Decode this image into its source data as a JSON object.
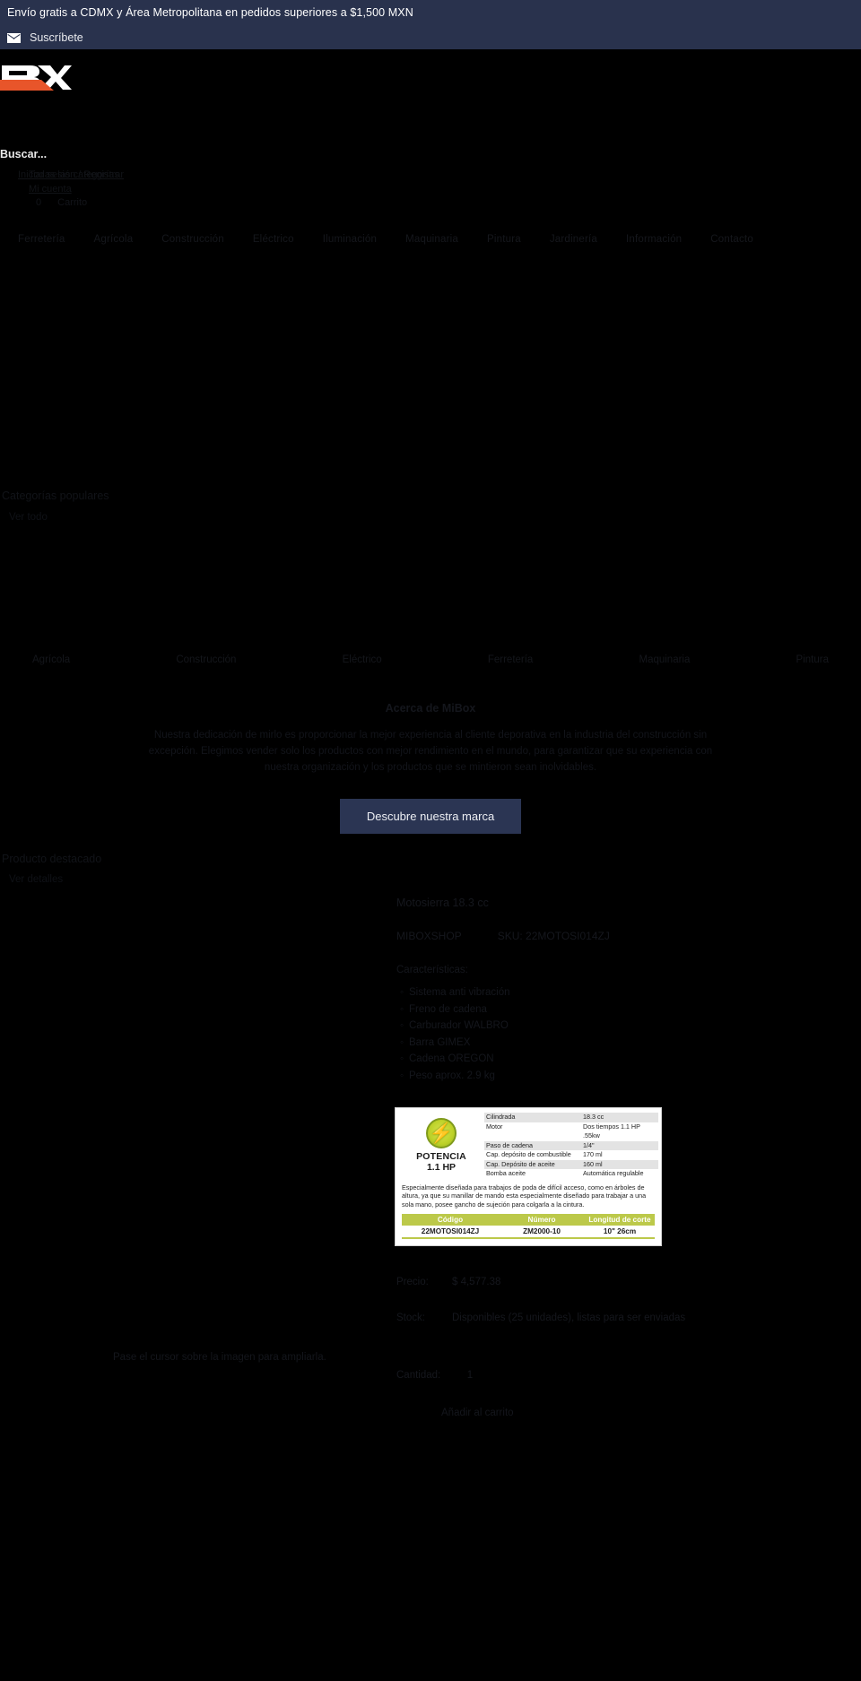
{
  "announcement": {
    "text": "Envío gratis a CDMX y Área Metropolitana en pedidos superiores a $1,500 MXN",
    "subscribe_label": "Suscríbete",
    "mail_icon": "envelope-icon",
    "bar_color": "#29324d"
  },
  "header": {
    "logo_text": "BOX",
    "logo_accent": "#e8552a",
    "search_placeholder": "Buscar...",
    "account": {
      "login_register": "Iniciar sesión / Registrar",
      "all_categories": "Todas las categorías",
      "my_account": "Mi cuenta"
    },
    "cart": {
      "count": "0",
      "label": "Carrito",
      "icon": "cart-icon"
    }
  },
  "nav": {
    "items": [
      {
        "label": "Ferretería"
      },
      {
        "label": "Agrícola"
      },
      {
        "label": "Construcción"
      },
      {
        "label": "Eléctrico"
      },
      {
        "label": "Iluminación"
      },
      {
        "label": "Maquinaria"
      },
      {
        "label": "Pintura"
      },
      {
        "label": "Jardinería"
      },
      {
        "label": "Información"
      },
      {
        "label": "Contacto"
      }
    ]
  },
  "popular": {
    "title": "Categorías populares",
    "see_all": "Ver todo",
    "categories": [
      {
        "label": "Agrícola"
      },
      {
        "label": "Construcción"
      },
      {
        "label": "Eléctrico"
      },
      {
        "label": "Ferretería"
      },
      {
        "label": "Maquinaria"
      },
      {
        "label": "Pintura"
      }
    ]
  },
  "about": {
    "title": "Acerca de MiBox",
    "body": "Nuestra dedicación de mirlo es proporcionar la mejor experiencia al cliente deporativa en la industria del construcción sin excepción. Elegimos vender solo los productos con mejor rendimiento en el mundo, para garantizar que su experiencia con nuestra organización y los productos que se mintieron sean inolvidables.",
    "button_label": "Descubre nuestra marca",
    "button_color": "#2b3553"
  },
  "featured": {
    "title": "Producto destacado",
    "see_details": "Ver detalles"
  },
  "product": {
    "name": "Motosierra 18.3 cc",
    "vendor": "MIBOXSHOP",
    "sku_label": "SKU:",
    "sku": "22MOTOSI014ZJ",
    "characteristics_title": "Características:",
    "characteristics": [
      "Sistema anti vibración",
      "Freno de cadena",
      "Carburador WALBRO",
      "Barra GIMEX",
      "Cadena OREGON",
      "Peso aprox. 2.9 kg"
    ],
    "price_label": "Precio:",
    "price": "$ 4,577.38",
    "stock_label": "Stock:",
    "stock": "Disponibles (25 unidades), listas para ser enviadas",
    "quantity_label": "Cantidad:",
    "quantity": "1",
    "add_to_cart": "Añadir al carrito",
    "zoom_hint": "Pase el cursor sobre la imagen para ampliarla.",
    "spec_image": {
      "power_label": "POTENCIA",
      "power_value": "1.1 HP",
      "bolt_icon": "lightning-bolt-icon",
      "rows": [
        {
          "key": "Cilindrada",
          "value": "18.3 cc"
        },
        {
          "key": "Motor",
          "value": "Dos tiempos 1.1 HP .55kw"
        },
        {
          "key": "Paso de cadena",
          "value": "1/4\""
        },
        {
          "key": "Cap. depósito de combustible",
          "value": "170 ml"
        },
        {
          "key": "Cap. Depósito de aceite",
          "value": "160 ml"
        },
        {
          "key": "Bomba aceite",
          "value": "Automática regulable"
        }
      ],
      "description": "Especialmente diseñada para trabajos de poda de difícil acceso, como en árboles de altura, ya que su manillar de mando esta especialmente diseñado para trabajar a una sola mano, posee gancho de sujeción para colgarla a la cintura.",
      "table_headers": [
        "Código",
        "Número",
        "Longitud de corte"
      ],
      "table_row": [
        "22MOTOSI014ZJ",
        "ZM2000-10",
        "10\"    26cm"
      ],
      "accent_color": "#bcc94a"
    }
  }
}
